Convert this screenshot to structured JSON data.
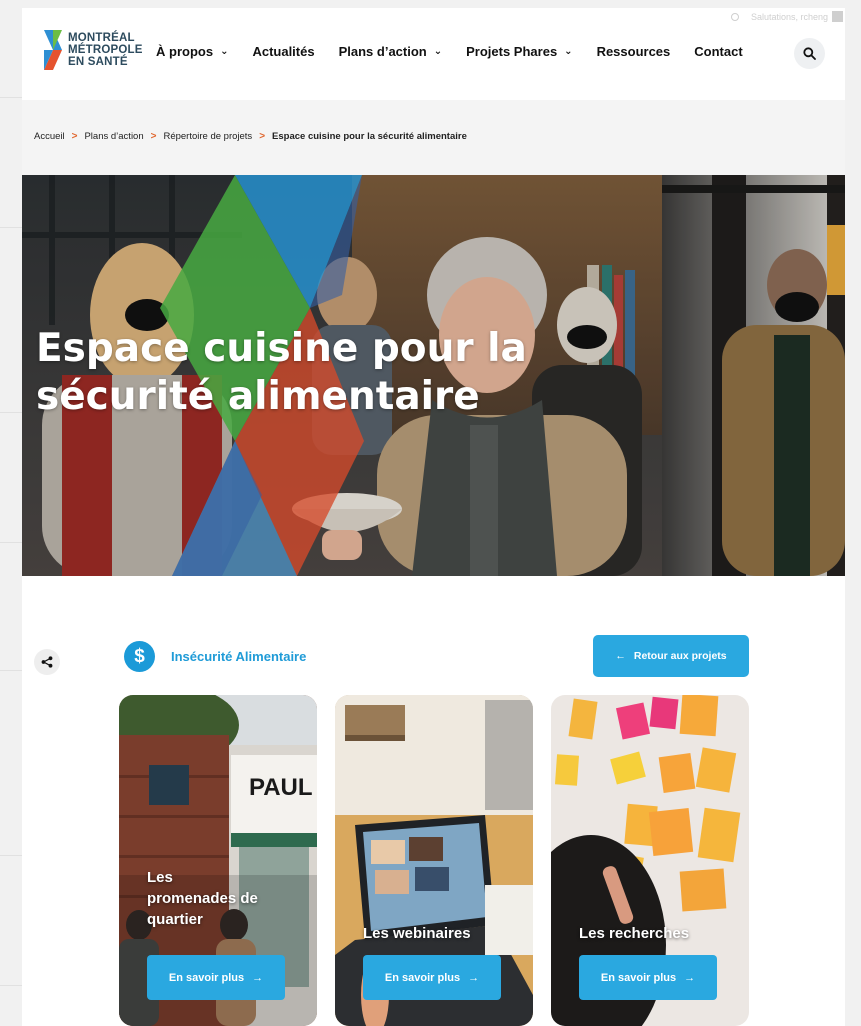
{
  "header": {
    "greeting": "Salutations, rcheng",
    "logo_lines": [
      "MONTRÉAL",
      "MÉTROPOLE",
      "EN SANTÉ"
    ],
    "nav": [
      {
        "label": "À propos",
        "dropdown": true
      },
      {
        "label": "Actualités",
        "dropdown": false
      },
      {
        "label": "Plans d’action",
        "dropdown": true
      },
      {
        "label": "Projets Phares",
        "dropdown": true
      },
      {
        "label": "Ressources",
        "dropdown": false
      },
      {
        "label": "Contact",
        "dropdown": false
      }
    ],
    "search_icon": "search-icon"
  },
  "breadcrumb": {
    "items": [
      "Accueil",
      "Plans d’action",
      "Répertoire de projets"
    ],
    "current": "Espace cuisine pour la sécurité alimentaire"
  },
  "hero": {
    "title_line1": "Espace cuisine pour la",
    "title_line2": "sécurité alimentaire"
  },
  "category": {
    "icon_glyph": "$",
    "label": "Insécurité Alimentaire"
  },
  "back_button": {
    "arrow": "←",
    "label": "Retour aux projets"
  },
  "cards": [
    {
      "title_lines": [
        "Les",
        "promenades de",
        "quartier"
      ],
      "button": "En savoir plus",
      "arrow": "→"
    },
    {
      "title_lines": [
        "Les webinaires"
      ],
      "button": "En savoir plus",
      "arrow": "→"
    },
    {
      "title_lines": [
        "Les recherches"
      ],
      "button": "En savoir plus",
      "arrow": "→"
    }
  ],
  "colors": {
    "accent_blue": "#2aa8e0",
    "category_blue": "#1b9ad8",
    "breadcrumb_sep": "#e0652c",
    "logo_text": "#2d4b5e"
  }
}
